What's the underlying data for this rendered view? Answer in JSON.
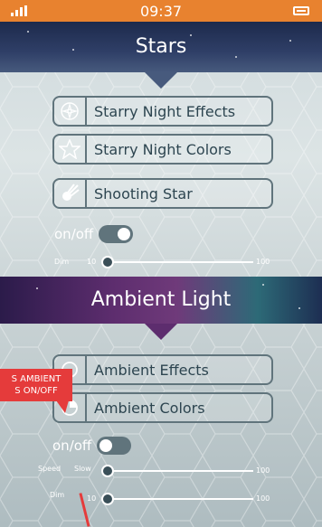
{
  "status_bar": {
    "time": "09:37",
    "signal_icon": "signal-icon",
    "battery_icon": "battery-icon"
  },
  "stars": {
    "title": "Stars",
    "buttons": [
      {
        "label": "Starry Night Effects",
        "icon": "compass-star-icon"
      },
      {
        "label": "Starry Night Colors",
        "icon": "star-outline-icon"
      },
      {
        "label": "Shooting Star",
        "icon": "shooting-star-icon"
      }
    ],
    "toggle": {
      "on": "on",
      "slash": "/",
      "off": "off",
      "state": "on"
    },
    "dim": {
      "label": "Dim",
      "min": "10",
      "max": "100",
      "value": 10
    }
  },
  "ambient": {
    "title": "Ambient Light",
    "buttons": [
      {
        "label": "Ambient Effects",
        "icon": "ambient-effects-icon"
      },
      {
        "label": "Ambient Colors",
        "icon": "ambient-colors-icon"
      }
    ],
    "toggle": {
      "on": "on",
      "slash": "/",
      "off": "off",
      "state": "off"
    },
    "speed": {
      "label": "Speed",
      "min": "Slow",
      "max": "100",
      "value": 0
    },
    "dim": {
      "label": "Dim",
      "min": "10",
      "max": "100",
      "value": 10
    }
  },
  "annotation": {
    "line1": "S AMBIENT",
    "line2": "S ON/OFF"
  },
  "colors": {
    "accent": "#e8822f",
    "annotation": "#e53b3b",
    "control": "#60747c"
  }
}
